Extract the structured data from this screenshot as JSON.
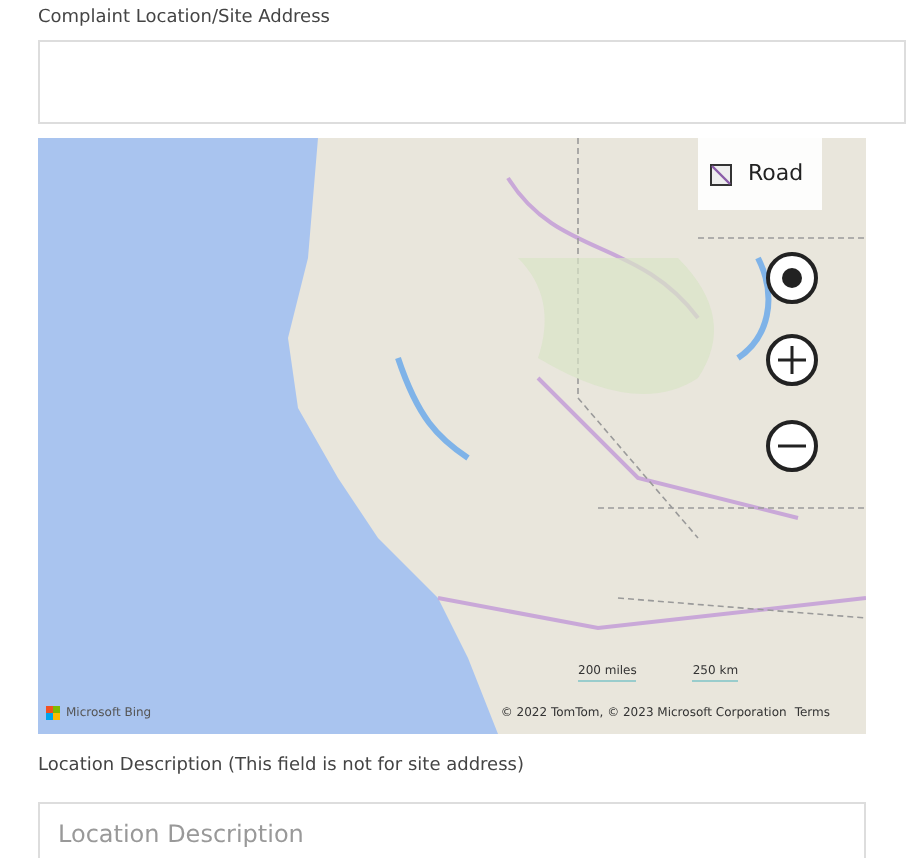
{
  "address_field": {
    "label": "Complaint Location/Site Address"
  },
  "map": {
    "style_button": "Road",
    "logo": "Microsoft Bing",
    "scale": [
      "200 miles",
      "250 km"
    ],
    "attribution": "© 2022 TomTom, © 2023 Microsoft Corporation",
    "terms_link": "Terms"
  },
  "description_field": {
    "label": "Location Description (This field is not for site address)",
    "placeholder": "Location Description"
  }
}
